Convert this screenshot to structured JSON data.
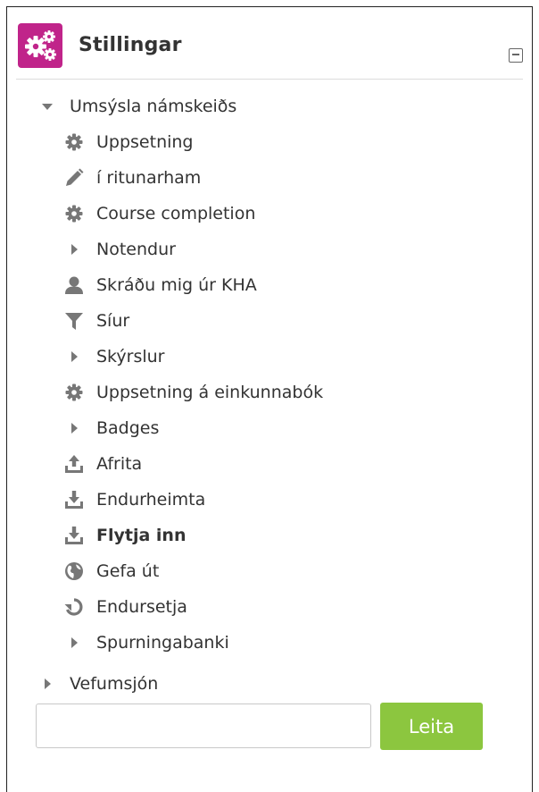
{
  "block": {
    "title": "Stillingar",
    "logo_icon": "cogs-icon",
    "collapse_icon": "collapse-minus-icon",
    "accent_color": "#c0248a"
  },
  "tree": {
    "course_admin": {
      "label": "Umsýsla námskeiðs",
      "icon": "caret-down-icon",
      "items": [
        {
          "label": "Uppsetning",
          "icon": "gear-icon"
        },
        {
          "label": "í ritunarham",
          "icon": "pencil-icon"
        },
        {
          "label": "Course completion",
          "icon": "gear-icon"
        },
        {
          "label": "Notendur",
          "icon": "caret-right-icon"
        },
        {
          "label": "Skráðu mig úr KHA",
          "icon": "user-icon"
        },
        {
          "label": "Síur",
          "icon": "filter-icon"
        },
        {
          "label": "Skýrslur",
          "icon": "caret-right-icon"
        },
        {
          "label": "Uppsetning á einkunnabók",
          "icon": "gear-icon"
        },
        {
          "label": "Badges",
          "icon": "caret-right-icon"
        },
        {
          "label": "Afrita",
          "icon": "upload-icon"
        },
        {
          "label": "Endurheimta",
          "icon": "download-icon"
        },
        {
          "label": "Flytja inn",
          "icon": "download-icon"
        },
        {
          "label": "Gefa út",
          "icon": "globe-icon"
        },
        {
          "label": "Endursetja",
          "icon": "reset-icon"
        },
        {
          "label": "Spurningabanki",
          "icon": "caret-right-icon"
        }
      ]
    },
    "site_admin": {
      "label": "Vefumsjón",
      "icon": "caret-right-icon"
    }
  },
  "search": {
    "value": "",
    "placeholder": "",
    "button_label": "Leita",
    "button_color": "#8cc63f"
  }
}
